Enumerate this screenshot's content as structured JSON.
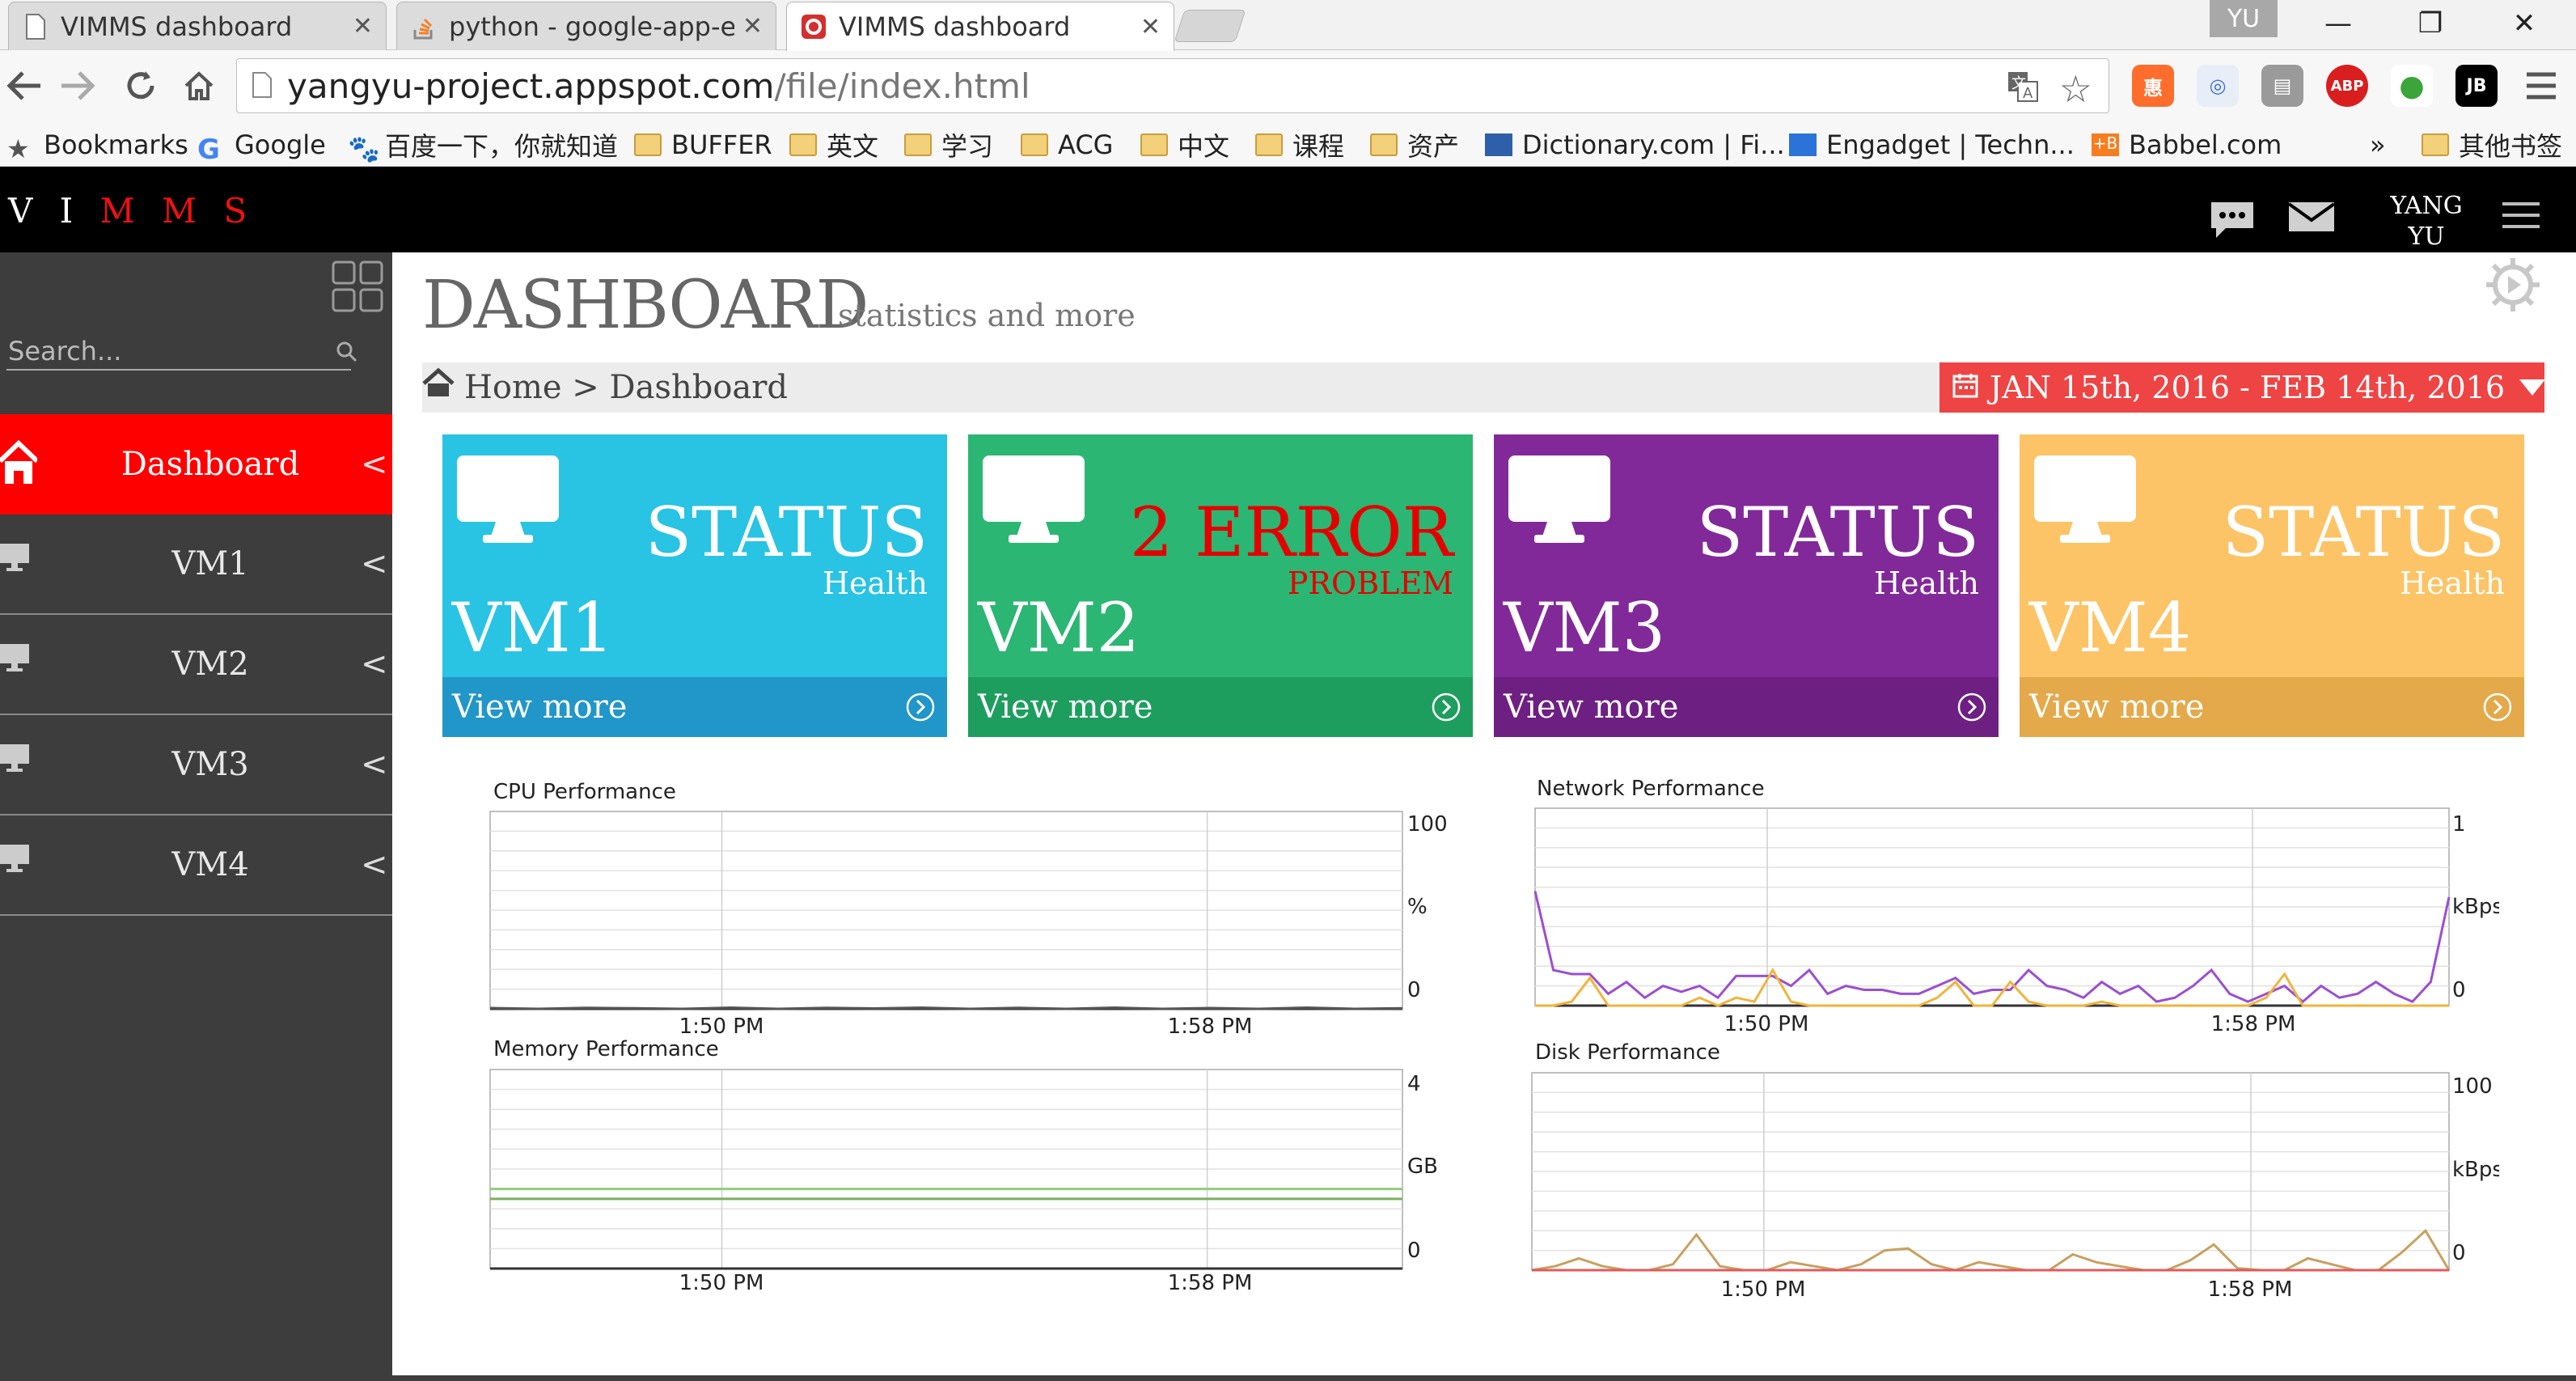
{
  "browser": {
    "tabs": [
      {
        "title": "VIMMS dashboard",
        "active": false
      },
      {
        "title": "python - google-app-en",
        "active": false
      },
      {
        "title": "VIMMS dashboard",
        "active": true
      }
    ],
    "user_badge": "YU",
    "url_host": "yangyu-project.appspot.com",
    "url_path": "/file/index.html",
    "bookmarks": [
      "Bookmarks",
      "Google",
      "百度一下，你就知道",
      "BUFFER",
      "英文",
      "学习",
      "ACG",
      "中文",
      "课程",
      "资产",
      "Dictionary.com | Fi...",
      "Engadget | Techn...",
      "Babbel.com"
    ],
    "bookmarks_more": "»",
    "other_bookmarks": "其他书签"
  },
  "app": {
    "brand_white": "V I",
    "brand_red": "M M S",
    "username_line1": "YANG",
    "username_line2": "YU"
  },
  "sidebar": {
    "search_placeholder": "Search...",
    "items": [
      {
        "label": "Dashboard",
        "active": true
      },
      {
        "label": "VM1",
        "active": false
      },
      {
        "label": "VM2",
        "active": false
      },
      {
        "label": "VM3",
        "active": false
      },
      {
        "label": "VM4",
        "active": false
      }
    ],
    "chevron": "<"
  },
  "page": {
    "title": "DASHBOARD",
    "subtitle": "statistics and more",
    "breadcrumb": "Home > Dashboard",
    "date_range": "JAN 15th, 2016 - FEB 14th, 2016"
  },
  "cards": [
    {
      "vm": "VM1",
      "status": "STATUS",
      "sub": "Health",
      "footer": "View more",
      "color": "#29c3e3",
      "footer_color": "#2196c8"
    },
    {
      "vm": "VM2",
      "status": "2 ERROR",
      "sub": "PROBLEM",
      "footer": "View more",
      "color": "#2bb673",
      "footer_color": "#1e9e5e"
    },
    {
      "vm": "VM3",
      "status": "STATUS",
      "sub": "Health",
      "footer": "View more",
      "color": "#82299a",
      "footer_color": "#6d1f82"
    },
    {
      "vm": "VM4",
      "status": "STATUS",
      "sub": "Health",
      "footer": "View more",
      "color": "#fcc466",
      "footer_color": "#e3a94a"
    }
  ],
  "charts": {
    "cpu": {
      "title": "CPU Performance",
      "y_top": "100",
      "y_unit": "%",
      "y_bottom": "0",
      "x_ticks": [
        "1:50 PM",
        "1:58 PM"
      ]
    },
    "memory": {
      "title": "Memory Performance",
      "y_top": "4",
      "y_unit": "GB",
      "y_bottom": "0",
      "x_ticks": [
        "1:50 PM",
        "1:58 PM"
      ]
    },
    "network": {
      "title": "Network Performance",
      "y_top": "1",
      "y_unit": "kBps",
      "y_bottom": "0",
      "x_ticks": [
        "1:50 PM",
        "1:58 PM"
      ]
    },
    "disk": {
      "title": "Disk Performance",
      "y_top": "100",
      "y_unit": "kBps",
      "y_bottom": "0",
      "x_ticks": [
        "1:50 PM",
        "1:58 PM"
      ]
    }
  },
  "chart_data": [
    {
      "type": "line",
      "title": "CPU Performance",
      "ylabel": "%",
      "ylim": [
        0,
        100
      ],
      "xticks": [
        "1:50 PM",
        "1:58 PM"
      ],
      "series": [
        {
          "values": [
            0.4,
            0,
            0.5,
            0.3,
            0,
            0.6,
            0,
            0.5,
            0.2,
            0.6,
            0,
            0.5,
            0,
            0.6,
            0,
            0.4,
            0,
            0.6,
            0,
            0.3
          ]
        }
      ]
    },
    {
      "type": "line",
      "title": "Memory Performance",
      "ylabel": "GB",
      "ylim": [
        0,
        4
      ],
      "xticks": [
        "1:50 PM",
        "1:58 PM"
      ],
      "series": [
        {
          "values": [
            1.6,
            1.6,
            1.6,
            1.6,
            1.6,
            1.6,
            1.6,
            1.6,
            1.6,
            1.6
          ]
        },
        {
          "values": [
            1.4,
            1.4,
            1.4,
            1.4,
            1.4,
            1.4,
            1.4,
            1.4,
            1.4,
            1.4
          ]
        }
      ]
    },
    {
      "type": "line",
      "title": "Network Performance",
      "ylabel": "kBps",
      "ylim": [
        0,
        1
      ],
      "xticks": [
        "1:50 PM",
        "1:58 PM"
      ],
      "series": [
        {
          "color": "#9b4fcf",
          "values": [
            0.58,
            0.18,
            0.16,
            0.16,
            0.06,
            0.12,
            0.04,
            0.1,
            0.07,
            0.1,
            0.04,
            0.15,
            0.15,
            0.15,
            0.1,
            0.18,
            0.06,
            0.1,
            0.08,
            0.08,
            0.06,
            0.06,
            0.1,
            0.14,
            0.06,
            0.08,
            0.08,
            0.18,
            0.1,
            0.08,
            0.04,
            0.12,
            0.06,
            0.1,
            0.02,
            0.04,
            0.1,
            0.18,
            0.06,
            0.02,
            0.06,
            0.1,
            0.02,
            0.1,
            0.04,
            0.06,
            0.12,
            0.06,
            0.02,
            0.12,
            0.55
          ]
        },
        {
          "color": "#f0b43c",
          "values": [
            0.0,
            0.0,
            0.02,
            0.14,
            0.0,
            0.0,
            0.0,
            0.0,
            0.0,
            0.04,
            0.0,
            0.04,
            0.02,
            0.18,
            0.02,
            0.0,
            0.0,
            0.0,
            0.0,
            0.0,
            0.0,
            0.0,
            0.04,
            0.12,
            0.0,
            0.0,
            0.12,
            0.02,
            0.0,
            0.0,
            0.0,
            0.02,
            0.0,
            0.0,
            0.0,
            0.0,
            0.0,
            0.0,
            0.0,
            0.0,
            0.04,
            0.16,
            0.0,
            0.0,
            0.0,
            0.0,
            0.0,
            0.0,
            0.0,
            0.0,
            0.0
          ]
        }
      ]
    },
    {
      "type": "line",
      "title": "Disk Performance",
      "ylabel": "kBps",
      "ylim": [
        0,
        100
      ],
      "xticks": [
        "1:50 PM",
        "1:58 PM"
      ],
      "series": [
        {
          "color": "#c8a060",
          "values": [
            0,
            2,
            6,
            2,
            0,
            0,
            3,
            18,
            2,
            0,
            0,
            4,
            2,
            0,
            3,
            10,
            11,
            3,
            0,
            4,
            2,
            0,
            0,
            8,
            4,
            2,
            0,
            0,
            5,
            13,
            1,
            0,
            0,
            6,
            3,
            0,
            0,
            9,
            20,
            0
          ]
        },
        {
          "color": "#e25a5a",
          "values": [
            0,
            0,
            0,
            0,
            0,
            0,
            0,
            0,
            0,
            0,
            0,
            0,
            0,
            0,
            0,
            0,
            0,
            0,
            0,
            0,
            0,
            0,
            0,
            0,
            0,
            0,
            0,
            0,
            0,
            0,
            0,
            0,
            0,
            0,
            0,
            0,
            0,
            0,
            0,
            0
          ]
        }
      ]
    }
  ]
}
